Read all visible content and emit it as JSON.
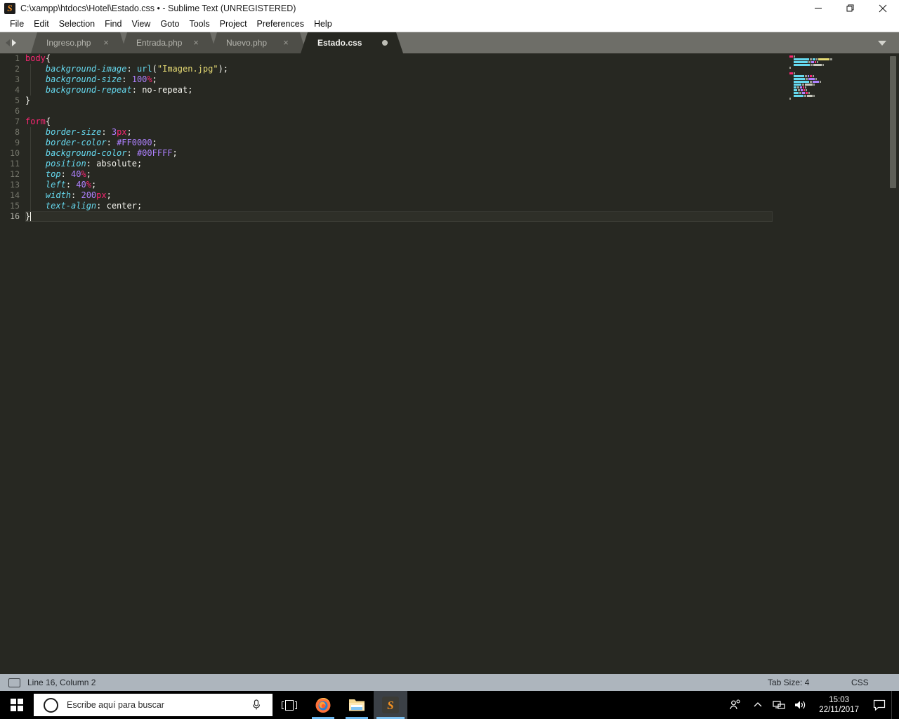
{
  "window": {
    "title": "C:\\xampp\\htdocs\\Hotel\\Estado.css • - Sublime Text (UNREGISTERED)",
    "app_icon": "sublime-text-icon",
    "controls": {
      "minimize": "minimize-icon",
      "restore": "restore-icon",
      "close": "close-icon"
    }
  },
  "menubar": {
    "items": [
      {
        "label": "File"
      },
      {
        "label": "Edit"
      },
      {
        "label": "Selection"
      },
      {
        "label": "Find"
      },
      {
        "label": "View"
      },
      {
        "label": "Goto"
      },
      {
        "label": "Tools"
      },
      {
        "label": "Project"
      },
      {
        "label": "Preferences"
      },
      {
        "label": "Help"
      }
    ]
  },
  "tabbar": {
    "nav_prev_icon": "arrow-left-icon",
    "nav_next_icon": "arrow-right-icon",
    "dropdown_icon": "chevron-down-icon",
    "close_glyph": "×",
    "tabs": [
      {
        "label": "Ingreso.php",
        "active": false,
        "dirty": false
      },
      {
        "label": "Entrada.php",
        "active": false,
        "dirty": false
      },
      {
        "label": "Nuevo.php",
        "active": false,
        "dirty": false
      },
      {
        "label": "Estado.css",
        "active": true,
        "dirty": true
      }
    ]
  },
  "editor": {
    "language": "CSS",
    "lines": [
      {
        "n": "1",
        "indent": 0,
        "tokens": [
          {
            "t": "body",
            "c": "sel"
          },
          {
            "t": "{",
            "c": "punc"
          }
        ]
      },
      {
        "n": "2",
        "indent": 1,
        "tokens": [
          {
            "t": "background-image",
            "c": "prop"
          },
          {
            "t": ": ",
            "c": "punc"
          },
          {
            "t": "url",
            "c": "fn"
          },
          {
            "t": "(",
            "c": "punc"
          },
          {
            "t": "\"Imagen.jpg\"",
            "c": "str"
          },
          {
            "t": ");",
            "c": "punc"
          }
        ]
      },
      {
        "n": "3",
        "indent": 1,
        "tokens": [
          {
            "t": "background-size",
            "c": "prop"
          },
          {
            "t": ": ",
            "c": "punc"
          },
          {
            "t": "100",
            "c": "num"
          },
          {
            "t": "%",
            "c": "unit"
          },
          {
            "t": ";",
            "c": "punc"
          }
        ]
      },
      {
        "n": "4",
        "indent": 1,
        "tokens": [
          {
            "t": "background-repeat",
            "c": "prop"
          },
          {
            "t": ": ",
            "c": "punc"
          },
          {
            "t": "no-repeat",
            "c": "val"
          },
          {
            "t": ";",
            "c": "punc"
          }
        ]
      },
      {
        "n": "5",
        "indent": 0,
        "tokens": [
          {
            "t": "}",
            "c": "punc"
          }
        ]
      },
      {
        "n": "6",
        "indent": 0,
        "tokens": []
      },
      {
        "n": "7",
        "indent": 0,
        "tokens": [
          {
            "t": "form",
            "c": "sel"
          },
          {
            "t": "{",
            "c": "punc"
          }
        ]
      },
      {
        "n": "8",
        "indent": 1,
        "tokens": [
          {
            "t": "border-size",
            "c": "prop"
          },
          {
            "t": ": ",
            "c": "punc"
          },
          {
            "t": "3",
            "c": "num"
          },
          {
            "t": "px",
            "c": "unit"
          },
          {
            "t": ";",
            "c": "punc"
          }
        ]
      },
      {
        "n": "9",
        "indent": 1,
        "tokens": [
          {
            "t": "border-color",
            "c": "prop"
          },
          {
            "t": ": ",
            "c": "punc"
          },
          {
            "t": "#FF0000",
            "c": "num"
          },
          {
            "t": ";",
            "c": "punc"
          }
        ]
      },
      {
        "n": "10",
        "indent": 1,
        "tokens": [
          {
            "t": "background-color",
            "c": "prop"
          },
          {
            "t": ": ",
            "c": "punc"
          },
          {
            "t": "#00FFFF",
            "c": "num"
          },
          {
            "t": ";",
            "c": "punc"
          }
        ]
      },
      {
        "n": "11",
        "indent": 1,
        "tokens": [
          {
            "t": "position",
            "c": "prop"
          },
          {
            "t": ": ",
            "c": "punc"
          },
          {
            "t": "absolute",
            "c": "val"
          },
          {
            "t": ";",
            "c": "punc"
          }
        ]
      },
      {
        "n": "12",
        "indent": 1,
        "tokens": [
          {
            "t": "top",
            "c": "prop"
          },
          {
            "t": ": ",
            "c": "punc"
          },
          {
            "t": "40",
            "c": "num"
          },
          {
            "t": "%",
            "c": "unit"
          },
          {
            "t": ";",
            "c": "punc"
          }
        ]
      },
      {
        "n": "13",
        "indent": 1,
        "tokens": [
          {
            "t": "left",
            "c": "prop"
          },
          {
            "t": ": ",
            "c": "punc"
          },
          {
            "t": "40",
            "c": "num"
          },
          {
            "t": "%",
            "c": "unit"
          },
          {
            "t": ";",
            "c": "punc"
          }
        ]
      },
      {
        "n": "14",
        "indent": 1,
        "tokens": [
          {
            "t": "width",
            "c": "prop"
          },
          {
            "t": ": ",
            "c": "punc"
          },
          {
            "t": "200",
            "c": "num"
          },
          {
            "t": "px",
            "c": "unit"
          },
          {
            "t": ";",
            "c": "punc"
          }
        ]
      },
      {
        "n": "15",
        "indent": 1,
        "tokens": [
          {
            "t": "text-align",
            "c": "prop"
          },
          {
            "t": ": ",
            "c": "punc"
          },
          {
            "t": "center",
            "c": "val"
          },
          {
            "t": ";",
            "c": "punc"
          }
        ]
      },
      {
        "n": "16",
        "indent": 0,
        "cursor_line": true,
        "caret_after": true,
        "tokens": [
          {
            "t": "}",
            "c": "punc"
          }
        ]
      }
    ]
  },
  "statusbar": {
    "layout_icon": "panel-icon",
    "caret_position": "Line 16, Column 2",
    "tab_size": "Tab Size: 4",
    "syntax": "CSS"
  },
  "taskbar": {
    "start_icon": "windows-logo-icon",
    "search_placeholder": "Escribe aquí para buscar",
    "search_icon": "search-circle-icon",
    "mic_icon": "microphone-icon",
    "taskview_icon": "task-view-icon",
    "apps": [
      {
        "name": "firefox-icon",
        "label": "Firefox",
        "active": false,
        "running": true
      },
      {
        "name": "explorer-icon",
        "label": "File Explorer",
        "active": false,
        "running": true
      },
      {
        "name": "sublime-icon",
        "label": "Sublime Text",
        "active": true,
        "running": true
      }
    ],
    "tray": {
      "people_icon": "people-icon",
      "overflow_icon": "chevron-up-icon",
      "network_icon": "network-icon",
      "volume_icon": "volume-icon",
      "time": "15:03",
      "date": "22/11/2017",
      "action_center_icon": "action-center-icon"
    }
  }
}
